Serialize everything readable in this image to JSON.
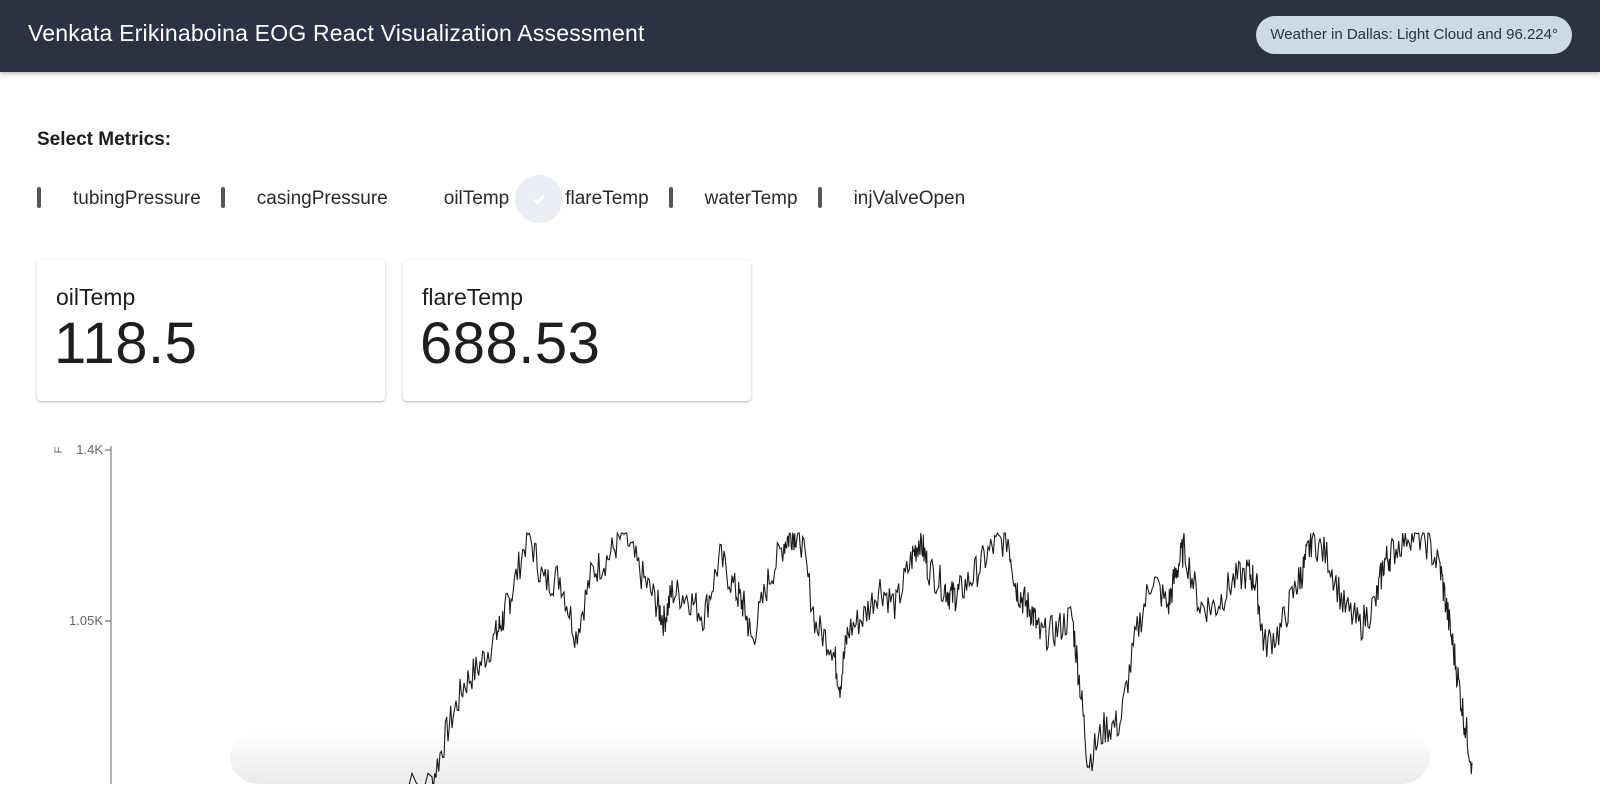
{
  "header": {
    "title": "Venkata Erikinaboina EOG React Visualization Assessment",
    "weather": "Weather in Dallas: Light Cloud and 96.224°"
  },
  "metrics_selector": {
    "heading": "Select Metrics:",
    "options": [
      {
        "label": "tubingPressure",
        "checked": false
      },
      {
        "label": "casingPressure",
        "checked": false
      },
      {
        "label": "oilTemp",
        "checked": true
      },
      {
        "label": "flareTemp",
        "checked": true
      },
      {
        "label": "waterTemp",
        "checked": false
      },
      {
        "label": "injValveOpen",
        "checked": false
      }
    ]
  },
  "cards": [
    {
      "title": "oilTemp",
      "value": "118.5"
    },
    {
      "title": "flareTemp",
      "value": "688.53"
    }
  ],
  "colors": {
    "appbar": "#2b3243",
    "chip": "#cdd9e5",
    "checkbox_checked": "#cdd6e1",
    "line": "#1a1a1a"
  },
  "chart_data": {
    "type": "line",
    "ylabel": "F",
    "yticks": [
      "1.4K",
      "1.05K"
    ],
    "ytick_values": [
      1400,
      1050
    ],
    "ylim": [
      700,
      1410
    ],
    "x": [
      0.24,
      0.27,
      0.28,
      0.29,
      0.3,
      0.31,
      0.315,
      0.32,
      0.33,
      0.34,
      0.35,
      0.36,
      0.37,
      0.38,
      0.39,
      0.4,
      0.41,
      0.415,
      0.42,
      0.43,
      0.44,
      0.45,
      0.46,
      0.465,
      0.47,
      0.48,
      0.49,
      0.495,
      0.5,
      0.51,
      0.52,
      0.525,
      0.53,
      0.54,
      0.55,
      0.56,
      0.57,
      0.575,
      0.58,
      0.59,
      0.595,
      0.6,
      0.61,
      0.62,
      0.63,
      0.635,
      0.64,
      0.645,
      0.65,
      0.66,
      0.67,
      0.675,
      0.68,
      0.69,
      0.7,
      0.71,
      0.72,
      0.73,
      0.735,
      0.74,
      0.75,
      0.76,
      0.77,
      0.78,
      0.785,
      0.79,
      0.8,
      0.81,
      0.815,
      0.82,
      0.83,
      0.84,
      0.85,
      0.86,
      0.865,
      0.87,
      0.88,
      0.89,
      0.9,
      0.905,
      0.91,
      0.915,
      0.92
    ],
    "y": [
      700,
      720,
      830,
      920,
      960,
      1020,
      1060,
      1110,
      1230,
      1130,
      1140,
      1020,
      1150,
      1180,
      1230,
      1150,
      1090,
      1050,
      1110,
      1100,
      1060,
      1180,
      1110,
      1080,
      1010,
      1130,
      1210,
      1230,
      1230,
      1040,
      1000,
      920,
      1030,
      1060,
      1120,
      1080,
      1180,
      1220,
      1160,
      1120,
      1100,
      1110,
      1150,
      1200,
      1220,
      1120,
      1090,
      1070,
      1020,
      1030,
      1060,
      920,
      760,
      830,
      840,
      1020,
      1140,
      1080,
      1150,
      1200,
      1080,
      1080,
      1130,
      1150,
      1130,
      1000,
      1030,
      1120,
      1160,
      1220,
      1180,
      1080,
      1040,
      1090,
      1170,
      1190,
      1230,
      1220,
      1160,
      1060,
      960,
      850,
      760
    ]
  }
}
